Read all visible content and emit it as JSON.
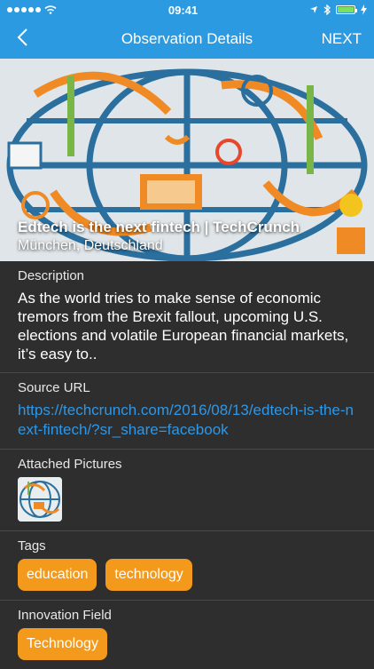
{
  "status_bar": {
    "time": "09:41",
    "battery_level": 1.0
  },
  "nav": {
    "back_icon": "chevron-left-icon",
    "title": "Observation Details",
    "next_label": "NEXT"
  },
  "hero": {
    "title": "Edtech is the next fintech  |  TechCrunch",
    "location": "München, Deutschland"
  },
  "description": {
    "label": "Description",
    "text": "As the world tries to make sense of economic tremors from the Brexit fallout, upcoming U.S. elections and volatile European financial markets, it’s easy to.."
  },
  "source_url": {
    "label": "Source URL",
    "url": "https://techcrunch.com/2016/08/13/edtech-is-the-next-fintech/?sr_share=facebook"
  },
  "attached_pictures": {
    "label": "Attached Pictures"
  },
  "tags": {
    "label": "Tags",
    "items": [
      "education",
      "technology"
    ]
  },
  "innovation_field": {
    "label": "Innovation Field",
    "value": "Technology"
  },
  "colors": {
    "accent": "#2b9ae0",
    "tag": "#f39a1c",
    "link": "#2f97e6",
    "background": "#2e2e2e"
  }
}
